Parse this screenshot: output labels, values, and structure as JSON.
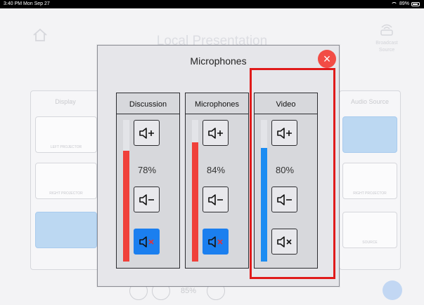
{
  "status_bar": {
    "time": "3:40 PM  Mon Sep 27",
    "battery": "89%",
    "battery_level": 0.89
  },
  "background": {
    "title": "Local Presentation",
    "broadcast": {
      "line1": "Broadcast",
      "line2": "Source"
    },
    "display_panel": {
      "title": "Display",
      "tiles": [
        "LEFT PROJECTOR",
        "RIGHT PROJECTOR",
        ""
      ]
    },
    "audio_panel": {
      "title": "Audio Source",
      "tiles": [
        "",
        "RIGHT PROJECTOR",
        "SOURCE"
      ]
    },
    "bottom_volume": "85%"
  },
  "modal": {
    "title": "Microphones",
    "close_label": "×",
    "channels": [
      {
        "name": "Discussion",
        "percent": "78%",
        "level": 0.78,
        "meter_color": "#f0403a",
        "muted": true
      },
      {
        "name": "Microphones",
        "percent": "84%",
        "level": 0.84,
        "meter_color": "#f0403a",
        "muted": true
      },
      {
        "name": "Video",
        "percent": "80%",
        "level": 0.8,
        "meter_color": "#1b8cf2",
        "muted": false
      }
    ]
  },
  "colors": {
    "accent_blue": "#1b7fef",
    "close_red": "#f24c45",
    "highlight_red": "#e01a1a"
  }
}
